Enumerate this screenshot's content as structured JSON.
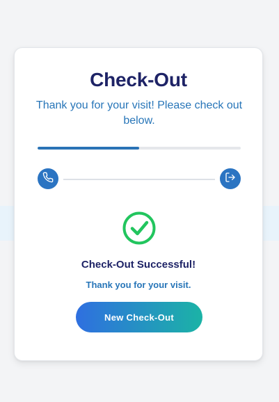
{
  "header": {
    "title": "Check-Out",
    "subtitle": "Thank you for your visit! Please check out below."
  },
  "progress": {
    "fraction": 0.5
  },
  "steps": [
    {
      "icon": "phone-icon"
    },
    {
      "icon": "exit-icon"
    }
  ],
  "result": {
    "icon": "check-circle-icon",
    "title": "Check-Out Successful!",
    "message": "Thank you for your visit."
  },
  "actions": {
    "new_checkout_label": "New Check-Out"
  },
  "colors": {
    "heading": "#1e2366",
    "accent": "#2775b8",
    "success": "#22c55e",
    "button_gradient_start": "#2f6fe0",
    "button_gradient_end": "#1bb3a6"
  }
}
